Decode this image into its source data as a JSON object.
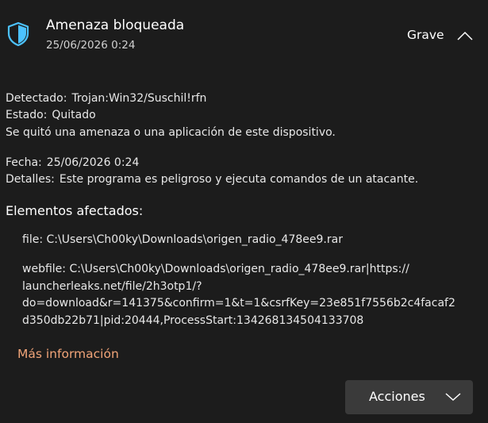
{
  "header": {
    "title": "Amenaza bloqueada",
    "date": "25/06/2026 0:24",
    "severity": "Grave",
    "shield_icon": "shield-icon",
    "collapse_icon": "chevron-up-icon"
  },
  "details": {
    "detected_label": "Detectado:",
    "detected_value": "Trojan:Win32/Suschil!rfn",
    "status_label": "Estado:",
    "status_value": "Quitado",
    "status_message": "Se quitó una amenaza o una aplicación de este dispositivo.",
    "date_label": "Fecha:",
    "date_value": "25/06/2026 0:24",
    "details_label": "Detalles:",
    "details_value": "Este programa es peligroso y ejecuta comandos de un atacante."
  },
  "affected": {
    "title": "Elementos afectados:",
    "items": [
      "file: C:\\Users\\Ch00ky\\Downloads\\origen_radio_478ee9.rar",
      "webfile: C:\\Users\\Ch00ky\\Downloads\\origen_radio_478ee9.rar|https://\nlauncherleaks.net/file/2h3otp1/?\ndo=download&r=141375&confirm=1&t=1&csrfKey=23e851f7556b2c4facaf2\nd350db22b71|pid:20444,ProcessStart:134268134504133708"
    ]
  },
  "more_info_label": "Más información",
  "actions": {
    "label": "Acciones",
    "icon": "chevron-down-icon"
  },
  "colors": {
    "background": "#1c1c1c",
    "accent_link": "#f0a478",
    "shield": "#4cc2ff",
    "button_bg": "#3a3a3a"
  }
}
